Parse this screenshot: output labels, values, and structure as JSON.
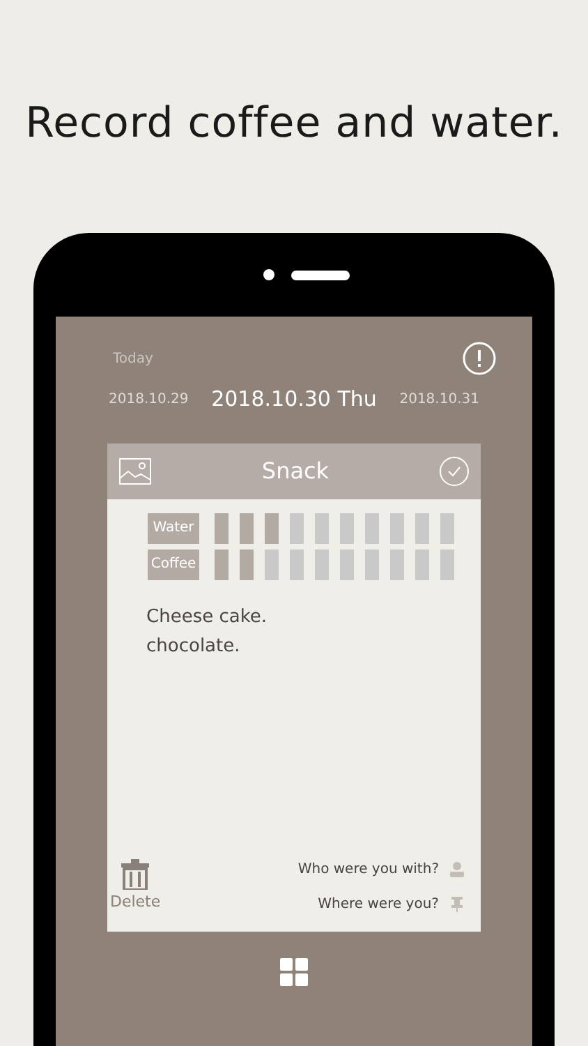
{
  "headline": "Record coffee and water.",
  "header": {
    "today_label": "Today",
    "prev_date": "2018.10.29",
    "current_date": "2018.10.30 Thu",
    "next_date": "2018.10.31"
  },
  "card": {
    "title": "Snack",
    "trackers": [
      {
        "label": "Water",
        "cups": [
          {
            "filled": true
          },
          {
            "filled": true
          },
          {
            "filled": true
          },
          {
            "filled": false
          },
          {
            "filled": false
          },
          {
            "filled": false
          },
          {
            "filled": false
          },
          {
            "filled": false
          },
          {
            "filled": false
          },
          {
            "filled": false
          }
        ]
      },
      {
        "label": "Coffee",
        "cups": [
          {
            "filled": true
          },
          {
            "filled": true
          },
          {
            "filled": false
          },
          {
            "filled": false
          },
          {
            "filled": false
          },
          {
            "filled": false
          },
          {
            "filled": false
          },
          {
            "filled": false
          },
          {
            "filled": false
          },
          {
            "filled": false
          }
        ]
      }
    ],
    "note_lines": [
      "Cheese cake.",
      "chocolate."
    ],
    "delete_label": "Delete",
    "who_prompt": "Who were you with?",
    "where_prompt": "Where were you?"
  }
}
